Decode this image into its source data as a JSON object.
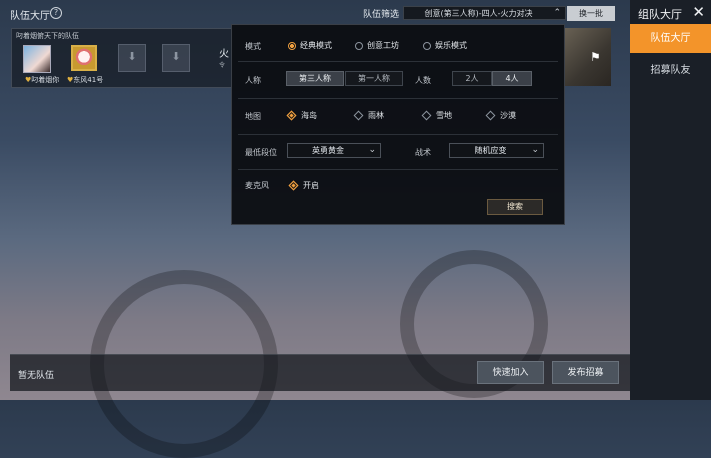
{
  "header": {
    "title": "队伍大厅",
    "help_icon": "?",
    "filter_label": "队伍筛选",
    "filter_value": "创意(第三人称)-四人-火力对决",
    "refresh_button": "换一批"
  },
  "right_panel": {
    "title": "组队大厅",
    "close_icon": "✕",
    "tabs": [
      {
        "label": "队伍大厅",
        "active": true
      },
      {
        "label": "招募队友",
        "active": false
      }
    ]
  },
  "team_card": {
    "label": "叼着烟俯天下的队伍",
    "members": [
      {
        "name": "叼着烟你"
      },
      {
        "name": "东风41号"
      }
    ],
    "partial_title": "火",
    "partial_sub": "令"
  },
  "filter_modal": {
    "mode": {
      "label": "模式",
      "options": [
        {
          "label": "经典模式",
          "selected": true
        },
        {
          "label": "创意工坊",
          "selected": false
        },
        {
          "label": "娱乐模式",
          "selected": false
        }
      ]
    },
    "perspective": {
      "label": "人称",
      "options": [
        {
          "label": "第三人称",
          "selected": true
        },
        {
          "label": "第一人称",
          "selected": false
        }
      ]
    },
    "players": {
      "label": "人数",
      "options": [
        {
          "label": "2人",
          "selected": false
        },
        {
          "label": "4人",
          "selected": true
        }
      ]
    },
    "map": {
      "label": "地图",
      "options": [
        {
          "label": "海岛",
          "selected": true
        },
        {
          "label": "雨林",
          "selected": false
        },
        {
          "label": "雪地",
          "selected": false
        },
        {
          "label": "沙漠",
          "selected": false
        }
      ]
    },
    "min_rank": {
      "label": "最低段位",
      "value": "英勇黄金"
    },
    "tactics": {
      "label": "战术",
      "value": "随机应变"
    },
    "mic": {
      "label": "麦克风",
      "option": "开启",
      "selected": true
    },
    "search_button": "搜索"
  },
  "bottom": {
    "status": "暂无队伍",
    "quick_join": "快速加入",
    "publish": "发布招募"
  },
  "colors": {
    "accent": "#f3942a",
    "selected": "#f0a040"
  }
}
